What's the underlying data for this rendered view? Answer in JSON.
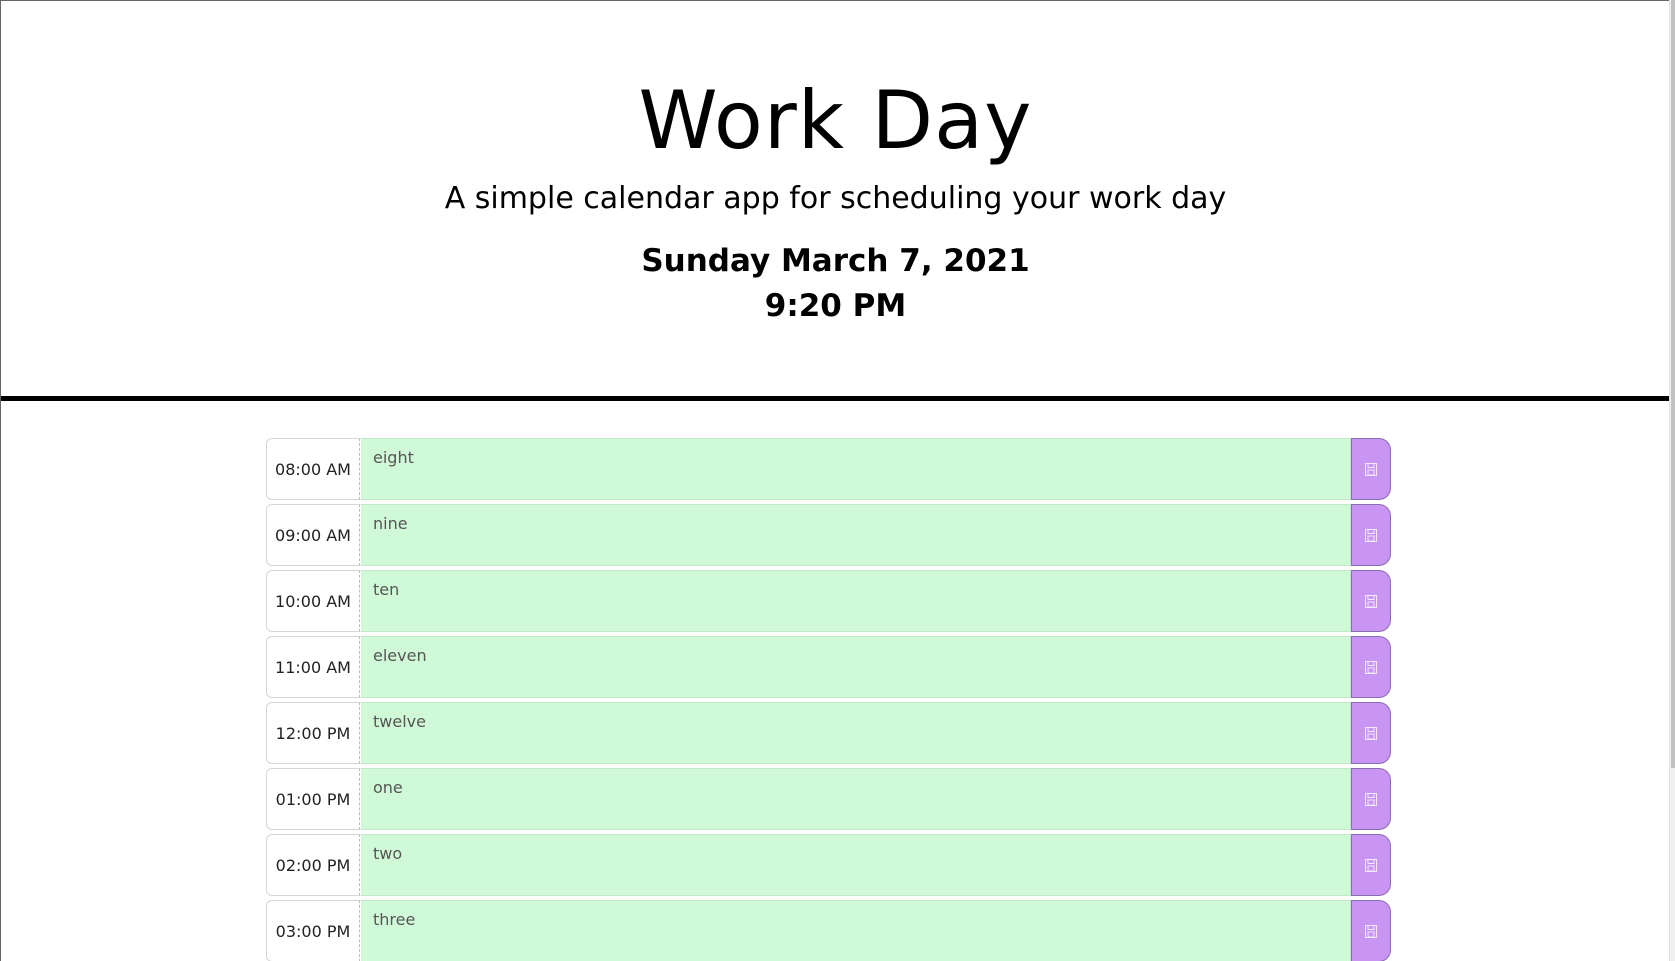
{
  "header": {
    "title": "Work Day",
    "subtitle": "A simple calendar app for scheduling your work day",
    "date": "Sunday March 7, 2021",
    "time": "9:20 PM"
  },
  "time_blocks": [
    {
      "hour": "08:00 AM",
      "text": "eight"
    },
    {
      "hour": "09:00 AM",
      "text": "nine"
    },
    {
      "hour": "10:00 AM",
      "text": "ten"
    },
    {
      "hour": "11:00 AM",
      "text": "eleven"
    },
    {
      "hour": "12:00 PM",
      "text": "twelve"
    },
    {
      "hour": "01:00 PM",
      "text": "one"
    },
    {
      "hour": "02:00 PM",
      "text": "two"
    },
    {
      "hour": "03:00 PM",
      "text": "three"
    }
  ],
  "colors": {
    "future_block": "#d0fad7",
    "save_button": "#c995f2",
    "divider": "#000000"
  },
  "icons": {
    "save": "floppy-disk-icon"
  }
}
